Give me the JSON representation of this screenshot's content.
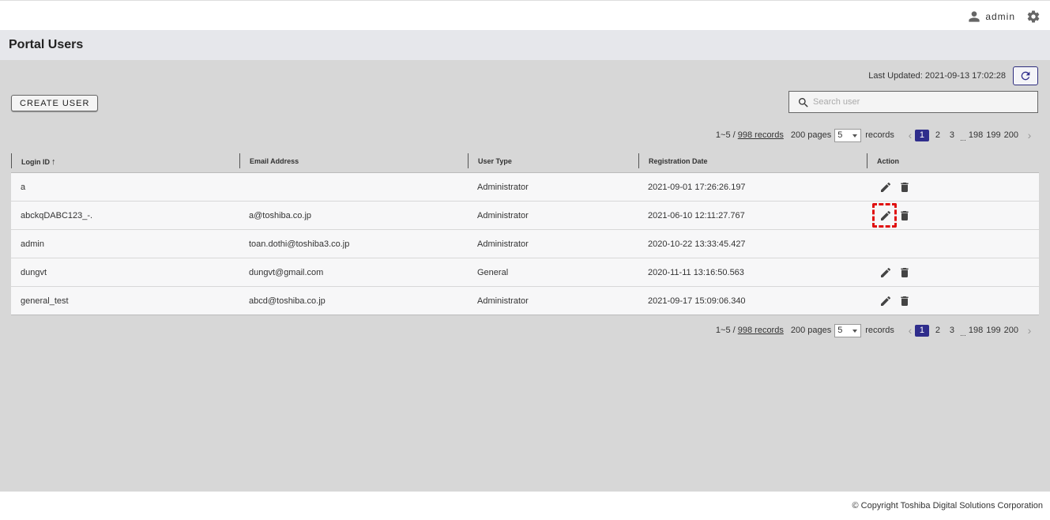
{
  "header": {
    "username": "admin",
    "user_icon": "person-icon",
    "settings_icon": "gear-icon"
  },
  "page": {
    "title": "Portal Users"
  },
  "toolbar": {
    "last_updated": "Last Updated: 2021-09-13 17:02:28",
    "refresh_icon": "refresh-icon",
    "create_user_label": "CREATE USER",
    "search_placeholder": "Search user",
    "search_value": ""
  },
  "pagination": {
    "range": "1~5 / ",
    "total_records": "998 records",
    "pages_count": "200 pages",
    "page_size": "5",
    "records_label": "records",
    "pages": [
      "1",
      "2",
      "3",
      "198",
      "199",
      "200"
    ],
    "ellipsis": "...",
    "current": "1"
  },
  "table": {
    "columns": {
      "login_id": "Login ID",
      "email": "Email Address",
      "user_type": "User Type",
      "registration_date": "Registration Date",
      "action": "Action"
    },
    "sort_icon": "arrow-up-icon",
    "rows": [
      {
        "login_id": "a",
        "email": "",
        "user_type": "Administrator",
        "registration_date": "2021-09-01 17:26:26.197",
        "actions": true
      },
      {
        "login_id": "abckqDABC123_-.",
        "email": "a@toshiba.co.jp",
        "user_type": "Administrator",
        "registration_date": "2021-06-10 12:11:27.767",
        "actions": true
      },
      {
        "login_id": "admin",
        "email": "toan.dothi@toshiba3.co.jp",
        "user_type": "Administrator",
        "registration_date": "2020-10-22 13:33:45.427",
        "actions": false
      },
      {
        "login_id": "dungvt",
        "email": "dungvt@gmail.com",
        "user_type": "General",
        "registration_date": "2020-11-11 13:16:50.563",
        "actions": true
      },
      {
        "login_id": "general_test",
        "email": "abcd@toshiba.co.jp",
        "user_type": "Administrator",
        "registration_date": "2021-09-17 15:09:06.340",
        "actions": true
      }
    ]
  },
  "footer": {
    "copyright": "© Copyright Toshiba Digital Solutions Corporation"
  },
  "colors": {
    "accent": "#2f2d8c",
    "highlight": "#e01010"
  }
}
